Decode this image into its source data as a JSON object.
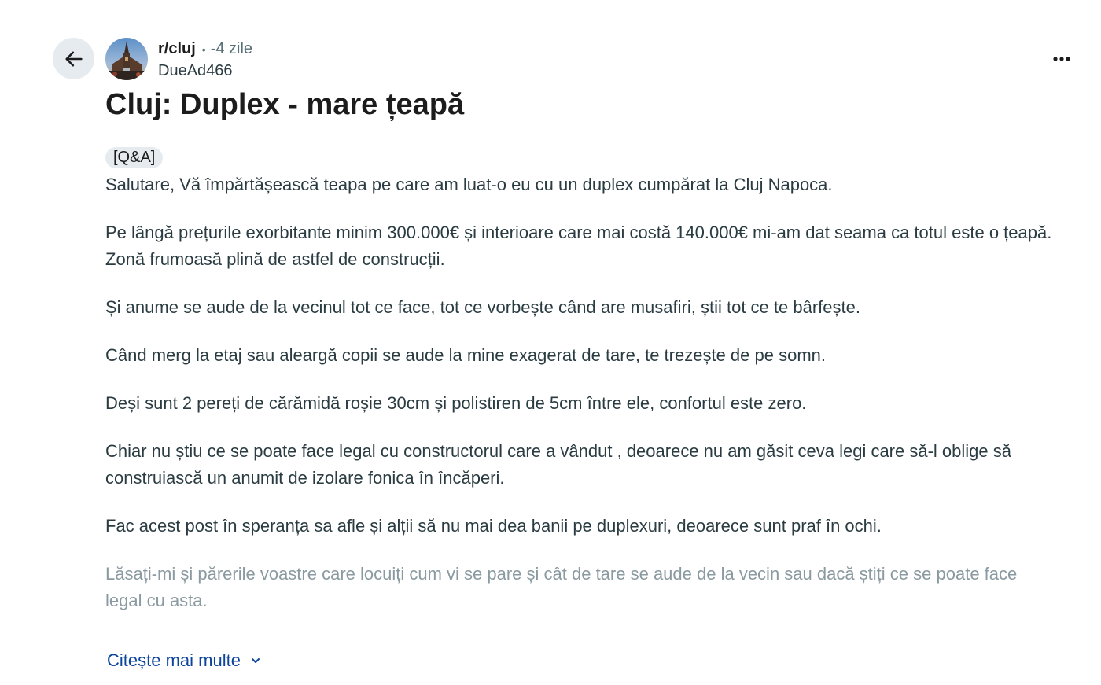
{
  "header": {
    "subreddit": "r/cluj",
    "separator": "•",
    "time_ago": "-4 zile",
    "author": "DueAd466"
  },
  "post": {
    "title": "Cluj: Duplex - mare țeapă",
    "flair": "[Q&A]",
    "paragraphs": [
      "Salutare, Vă împărtășească teapa pe care am luat-o eu cu un duplex cumpărat la Cluj Napoca.",
      "Pe lângă prețurile exorbitante minim 300.000€ și interioare care mai costă 140.000€ mi-am dat seama ca totul este o țeapă. Zonă frumoasă plină de astfel de construcții.",
      "Și anume se aude de la vecinul tot ce face, tot ce vorbește când are musafiri, știi tot ce te bârfește.",
      "Când merg la etaj sau aleargă copii se aude la mine exagerat de tare, te trezește de pe somn.",
      "Deși sunt 2 pereți de cărămidă roșie 30cm și polistiren de 5cm între ele, confortul este zero.",
      "Chiar nu știu ce se poate face legal cu constructorul care a vândut , deoarece nu am găsit ceva legi care să-l oblige să construiască un anumit de izolare fonica în încăperi.",
      "Fac acest post în speranța sa afle și alții să nu mai dea banii pe duplexuri, deoarece sunt praf în ochi.",
      "Lăsați-mi și părerile voastre care locuiți cum vi se pare și cât de tare se aude de la vecin sau dacă știți ce se poate face legal cu asta."
    ],
    "read_more_label": "Citește mai multe"
  },
  "icons": {
    "back": "arrow-left-icon",
    "more": "three-dots-icon",
    "expand": "chevron-down-icon"
  },
  "colors": {
    "link": "#0a449b",
    "muted": "#576f76",
    "chip_bg": "#e5ebee"
  }
}
